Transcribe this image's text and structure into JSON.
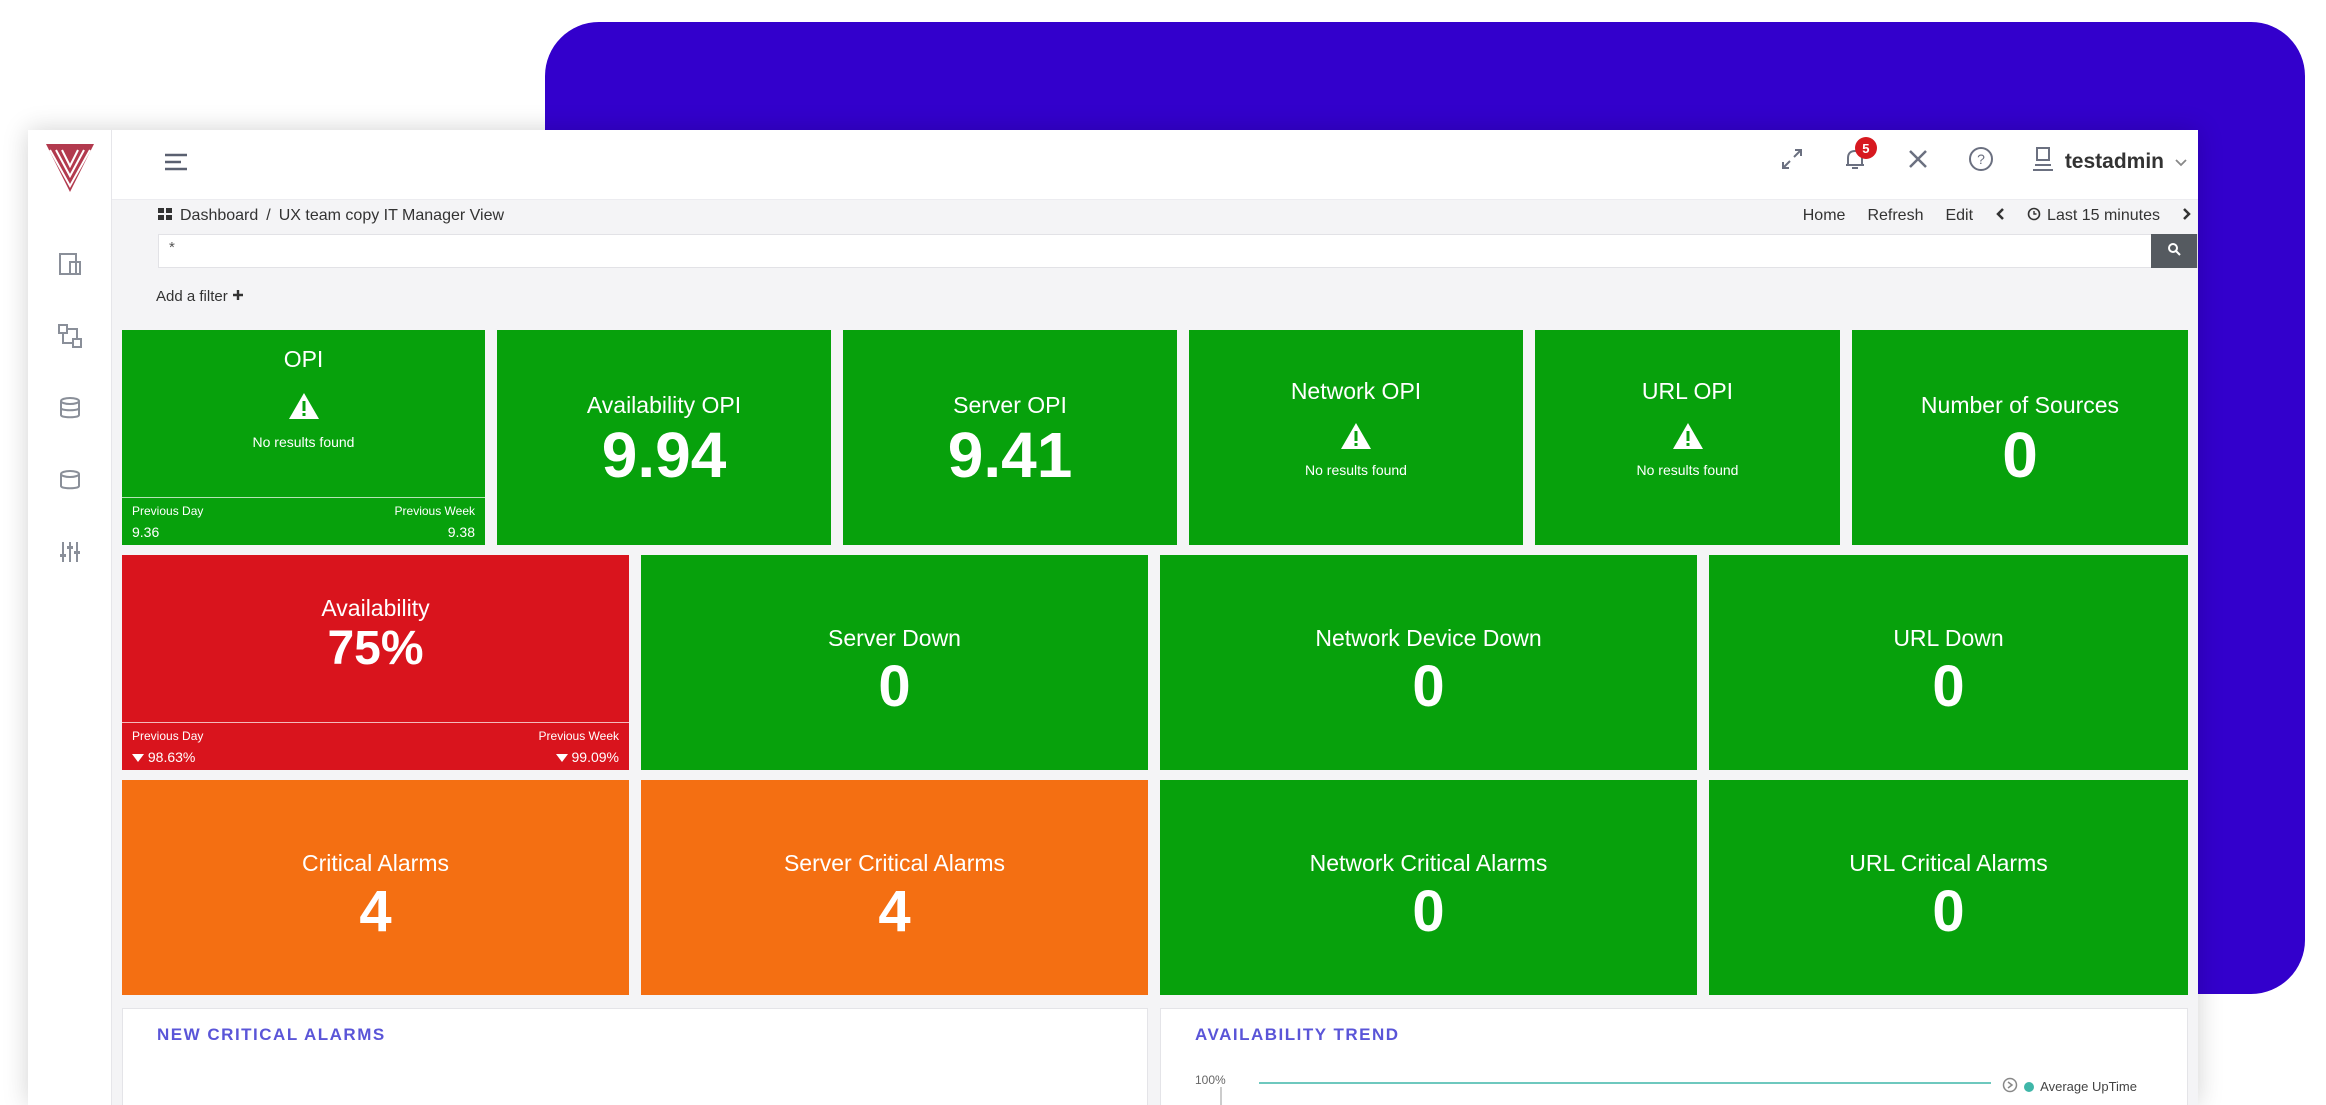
{
  "header": {
    "notification_count": "5",
    "username": "testadmin"
  },
  "breadcrumb": {
    "root": "Dashboard",
    "separator": "/",
    "current": "UX team copy IT Manager View"
  },
  "actions": {
    "home": "Home",
    "refresh": "Refresh",
    "edit": "Edit",
    "time_range": "Last 15 minutes"
  },
  "query": {
    "value": "*"
  },
  "filter": {
    "add_label": "Add a filter"
  },
  "tiles": {
    "opi": {
      "title": "OPI",
      "message": "No results found",
      "prev_day_label": "Previous Day",
      "prev_day_value": "9.36",
      "prev_week_label": "Previous Week",
      "prev_week_value": "9.38"
    },
    "availability_opi": {
      "title": "Availability OPI",
      "value": "9.94"
    },
    "server_opi": {
      "title": "Server OPI",
      "value": "9.41"
    },
    "network_opi": {
      "title": "Network OPI",
      "message": "No results found"
    },
    "url_opi": {
      "title": "URL OPI",
      "message": "No results found"
    },
    "number_of_sources": {
      "title": "Number of Sources",
      "value": "0"
    },
    "availability": {
      "title": "Availability",
      "value": "75%",
      "prev_day_label": "Previous Day",
      "prev_day_value": "98.63%",
      "prev_week_label": "Previous Week",
      "prev_week_value": "99.09%"
    },
    "server_down": {
      "title": "Server Down",
      "value": "0"
    },
    "network_device_down": {
      "title": "Network Device Down",
      "value": "0"
    },
    "url_down": {
      "title": "URL Down",
      "value": "0"
    },
    "critical_alarms": {
      "title": "Critical Alarms",
      "value": "4"
    },
    "server_critical_alarms": {
      "title": "Server Critical Alarms",
      "value": "4"
    },
    "network_critical_alarms": {
      "title": "Network Critical Alarms",
      "value": "0"
    },
    "url_critical_alarms": {
      "title": "URL Critical Alarms",
      "value": "0"
    }
  },
  "panels": {
    "new_critical_alarms": {
      "title": "NEW CRITICAL ALARMS"
    },
    "availability_trend": {
      "title": "AVAILABILITY TREND",
      "y_tick": "100%",
      "legend": "Average UpTime"
    }
  },
  "colors": {
    "accent": "#3300cc",
    "ok": "#07a10c",
    "critical": "#d9141d",
    "warning": "#f46f12",
    "panel_title": "#5a55d8"
  }
}
